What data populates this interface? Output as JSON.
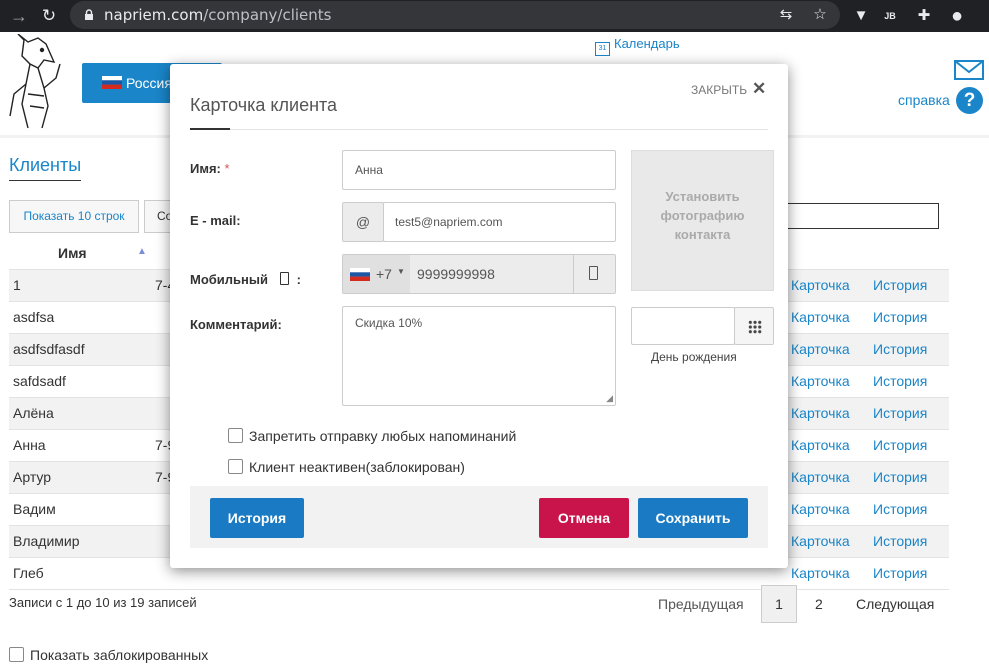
{
  "browser": {
    "url_host": "napriem.com",
    "url_path": "/company/clients",
    "icons": [
      "back-icon",
      "reload-icon",
      "lock-icon",
      "translate-icon",
      "star-icon",
      "vue-devtools-icon",
      "jb-extension-icon",
      "extensions-icon",
      "profile-icon"
    ]
  },
  "header": {
    "region_label": "Россия",
    "calendar_label": "Календарь",
    "help_label": "справка",
    "help_symbol": "?"
  },
  "clients": {
    "title": "Клиенты",
    "show_rows_label": "Показать 10 строк",
    "second_button_label": "Co",
    "column_name": "Имя",
    "rows": [
      {
        "name": "1",
        "phone": "7-4",
        "card": "Карточка",
        "history": "История"
      },
      {
        "name": "asdfsa",
        "phone": "",
        "card": "Карточка",
        "history": "История"
      },
      {
        "name": "asdfsdfasdf",
        "phone": "",
        "card": "Карточка",
        "history": "История"
      },
      {
        "name": "safdsadf",
        "phone": "",
        "card": "Карточка",
        "history": "История"
      },
      {
        "name": "Алёна",
        "phone": "",
        "card": "Карточка",
        "history": "История"
      },
      {
        "name": "Анна",
        "phone": "7-9",
        "card": "Карточка",
        "history": "История"
      },
      {
        "name": "Артур",
        "phone": "7-9",
        "card": "Карточка",
        "history": "История"
      },
      {
        "name": "Вадим",
        "phone": "",
        "card": "Карточка",
        "history": "История"
      },
      {
        "name": "Владимир",
        "phone": "",
        "card": "Карточка",
        "history": "История"
      },
      {
        "name": "Глеб",
        "phone": "",
        "card": "Карточка",
        "history": "История"
      }
    ],
    "records_info": "Записи с 1 до 10 из 19 записей",
    "pager": {
      "prev": "Предыдущая",
      "page1": "1",
      "page2": "2",
      "next": "Следующая"
    },
    "show_blocked_label": "Показать заблокированных"
  },
  "modal": {
    "title": "Карточка клиента",
    "close_label": "ЗАКРЫТЬ",
    "name_label": "Имя:",
    "required_mark": "*",
    "name_value": "Анна",
    "email_label": "E - mail:",
    "email_addon": "@",
    "email_value": "test5@napriem.com",
    "mobile_label": "Мобильный",
    "mobile_colon": ":",
    "country_code": "+7",
    "phone_value": "9999999998",
    "comment_label": "Комментарий:",
    "comment_value": "Скидка 10%",
    "photo_text": "Установить фотографию контакта",
    "birthday_label": "День рождения",
    "birthday_value": "",
    "checkbox_no_reminders": "Запретить отправку любых напоминаний",
    "checkbox_inactive": "Клиент неактивен(заблокирован)",
    "history_button": "История",
    "cancel_button": "Отмена",
    "save_button": "Сохранить"
  },
  "colors": {
    "primary": "#1a85c8",
    "cancel": "#c9134b",
    "browser_chrome": "#202124"
  }
}
